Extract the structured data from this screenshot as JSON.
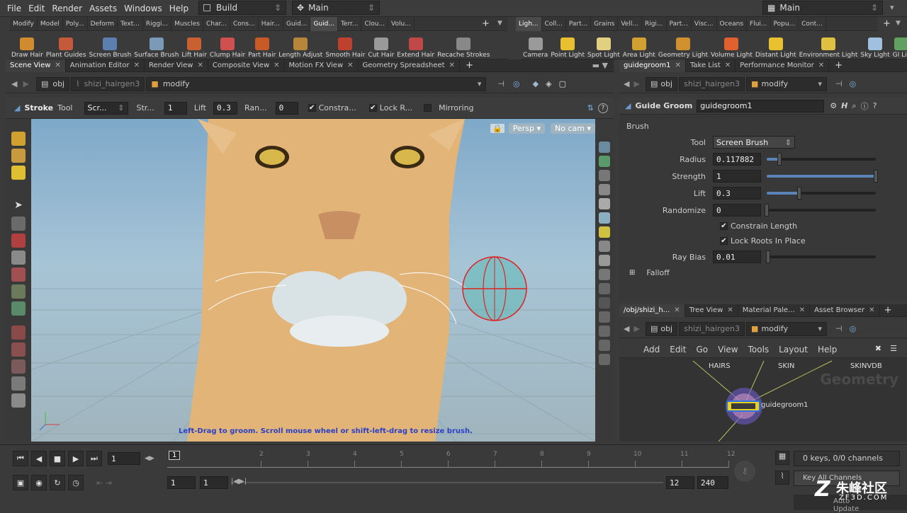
{
  "menu": [
    "File",
    "Edit",
    "Render",
    "Assets",
    "Windows",
    "Help"
  ],
  "desktop": {
    "build": "Build",
    "main": "Main",
    "right_main": "Main"
  },
  "shelf_tabs_left": [
    {
      "label": "Modify",
      "active": false
    },
    {
      "label": "Model",
      "active": false
    },
    {
      "label": "Poly...",
      "active": false
    },
    {
      "label": "Deform",
      "active": false
    },
    {
      "label": "Text...",
      "active": false
    },
    {
      "label": "Riggi...",
      "active": false
    },
    {
      "label": "Muscles",
      "active": false
    },
    {
      "label": "Char...",
      "active": false
    },
    {
      "label": "Cons...",
      "active": false
    },
    {
      "label": "Hair...",
      "active": false
    },
    {
      "label": "Guid...",
      "active": false
    },
    {
      "label": "Guid...",
      "active": true
    },
    {
      "label": "Terr...",
      "active": false
    },
    {
      "label": "Clou...",
      "active": false
    },
    {
      "label": "Volu...",
      "active": false
    }
  ],
  "shelf_tabs_right": [
    {
      "label": "Ligh...",
      "active": true
    },
    {
      "label": "Coll...",
      "active": false
    },
    {
      "label": "Part...",
      "active": false
    },
    {
      "label": "Grains",
      "active": false
    },
    {
      "label": "Vell...",
      "active": false
    },
    {
      "label": "Rigi...",
      "active": false
    },
    {
      "label": "Part...",
      "active": false
    },
    {
      "label": "Visc...",
      "active": false
    },
    {
      "label": "Oceans",
      "active": false
    },
    {
      "label": "Flui...",
      "active": false
    },
    {
      "label": "Popu...",
      "active": false
    },
    {
      "label": "Cont...",
      "active": false
    }
  ],
  "shelf_tools_left": [
    {
      "label": "Draw Hair",
      "color": "#d08a30"
    },
    {
      "label": "Plant Guides",
      "color": "#c45a3a"
    },
    {
      "label": "Screen Brush",
      "color": "#5a7fb0"
    },
    {
      "label": "Surface Brush",
      "color": "#7a9ab8"
    },
    {
      "label": "Lift Hair",
      "color": "#c86030"
    },
    {
      "label": "Clump Hair",
      "color": "#d05050"
    },
    {
      "label": "Part Hair",
      "color": "#c85a28"
    },
    {
      "label": "Length Adjust",
      "color": "#b8863a"
    },
    {
      "label": "Smooth Hair",
      "color": "#c04030"
    },
    {
      "label": "Cut Hair",
      "color": "#9a9a9a"
    },
    {
      "label": "Extend Hair",
      "color": "#c04848"
    },
    {
      "label": "Recache Strokes",
      "color": "#888888"
    }
  ],
  "shelf_tools_right": [
    {
      "label": "Camera",
      "color": "#9a9a9a"
    },
    {
      "label": "Point Light",
      "color": "#e8c030"
    },
    {
      "label": "Spot Light",
      "color": "#e0d080"
    },
    {
      "label": "Area Light",
      "color": "#d0a030"
    },
    {
      "label": "Geometry Light",
      "color": "#d09030"
    },
    {
      "label": "Volume Light",
      "color": "#e06030"
    },
    {
      "label": "Distant Light",
      "color": "#e8c030"
    },
    {
      "label": "Environment Light",
      "color": "#e0c040"
    },
    {
      "label": "Sky Light",
      "color": "#a0c0e0"
    },
    {
      "label": "GI Lig",
      "color": "#60a060"
    }
  ],
  "left_tabs": [
    {
      "label": "Scene View",
      "active": true
    },
    {
      "label": "Animation Editor",
      "active": false
    },
    {
      "label": "Render View",
      "active": false
    },
    {
      "label": "Composite View",
      "active": false
    },
    {
      "label": "Motion FX View",
      "active": false
    },
    {
      "label": "Geometry Spreadsheet",
      "active": false
    }
  ],
  "right_top_tabs": [
    {
      "label": "guidegroom1",
      "active": true
    },
    {
      "label": "Take List",
      "active": false
    },
    {
      "label": "Performance Monitor",
      "active": false
    }
  ],
  "right_bottom_tabs": [
    {
      "label": "/obj/shizi_h...",
      "active": true
    },
    {
      "label": "Tree View",
      "active": false
    },
    {
      "label": "Material Pale...",
      "active": false
    },
    {
      "label": "Asset Browser",
      "active": false
    }
  ],
  "path": {
    "obj": "obj",
    "geo": "shizi_hairgen3",
    "node": "modify"
  },
  "tool_options": {
    "name": "Stroke",
    "tool": "Tool",
    "mode": "Scr...",
    "str_label": "Str...",
    "str_value": "1",
    "lift_label": "Lift",
    "lift_value": "0.3",
    "ran_label": "Ran...",
    "ran_value": "0",
    "constrain": "Constra...",
    "lock": "Lock R...",
    "mirroring": "Mirroring"
  },
  "viewport": {
    "persp": "Persp",
    "cam": "No cam",
    "hint": "Left-Drag to groom. Scroll mouse wheel or shift-left-drag to resize brush."
  },
  "params": {
    "type_label": "Guide Groom",
    "node_name": "guidegroom1",
    "section": "Brush",
    "tool_label": "Tool",
    "tool_value": "Screen Brush",
    "radius_label": "Radius",
    "radius_value": "0.117882",
    "radius_frac": 0.117882,
    "strength_label": "Strength",
    "strength_value": "1",
    "strength_frac": 1.0,
    "lift_label": "Lift",
    "lift_value": "0.3",
    "lift_frac": 0.3,
    "randomize_label": "Randomize",
    "randomize_value": "0",
    "randomize_frac": 0.0,
    "constrain_length": "Constrain Length",
    "lock_roots": "Lock Roots In Place",
    "ray_bias_label": "Ray Bias",
    "ray_bias_value": "0.01",
    "ray_bias_frac": 0.01,
    "falloff": "Falloff"
  },
  "network": {
    "menu": [
      "Add",
      "Edit",
      "Go",
      "View",
      "Tools",
      "Layout",
      "Help"
    ],
    "watermark": "Geometry",
    "nodes": {
      "hairs": "HAIRS",
      "skin": "SKIN",
      "skinvdb": "SKINVDB",
      "guidegroom": "guidegroom1"
    }
  },
  "timeline": {
    "frame": "1",
    "marker": "1",
    "ticks": [
      "1",
      "2",
      "3",
      "4",
      "5",
      "6",
      "7",
      "8",
      "9",
      "10",
      "11",
      "12"
    ],
    "start": "1",
    "start2": "1",
    "end": "12",
    "end2": "240",
    "keys": "0 keys, 0/0 channels",
    "key_all": "Key All Channels",
    "auto_update": "Auto Update"
  },
  "watermark": {
    "brand": "朱峰社区",
    "site": "ZF3D.COM"
  }
}
